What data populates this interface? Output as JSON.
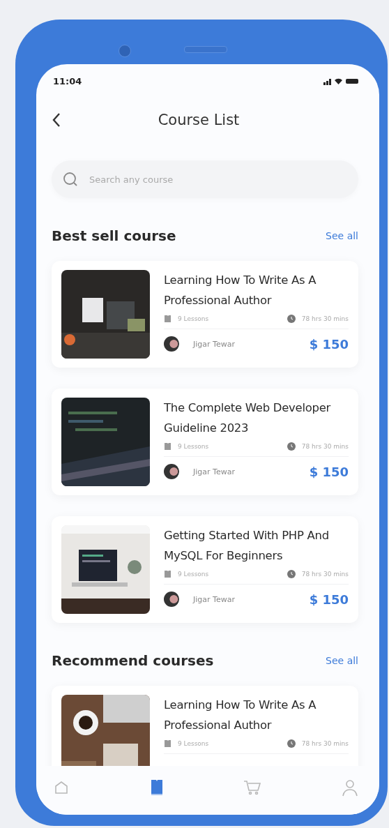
{
  "status_bar": {
    "time": "11:04"
  },
  "header": {
    "title": "Course List"
  },
  "search": {
    "placeholder": "Search any course"
  },
  "sections": [
    {
      "title": "Best sell course",
      "link": "See all",
      "courses": [
        {
          "title": "Learning How To Write As A Professional Author",
          "lessons": "9 Lessons",
          "duration": "78 hrs 30 mins",
          "author": "Jigar Tewar",
          "price": "$ 150"
        },
        {
          "title": "The Complete Web Developer Guideline 2023",
          "lessons": "9 Lessons",
          "duration": "78 hrs 30 mins",
          "author": "Jigar Tewar",
          "price": "$ 150"
        },
        {
          "title": "Getting Started With PHP And MySQL For Beginners",
          "lessons": "9 Lessons",
          "duration": "78 hrs 30 mins",
          "author": "Jigar Tewar",
          "price": "$ 150"
        }
      ]
    },
    {
      "title": "Recommend courses",
      "link": "See all",
      "courses": [
        {
          "title": "Learning How To Write As A Professional Author",
          "lessons": "9 Lessons",
          "duration": "78 hrs 30 mins"
        }
      ]
    }
  ],
  "nav": [
    {
      "kind": "home",
      "selected": false
    },
    {
      "kind": "book",
      "selected": true
    },
    {
      "kind": "cart",
      "selected": false
    },
    {
      "kind": "profile",
      "selected": false
    }
  ]
}
